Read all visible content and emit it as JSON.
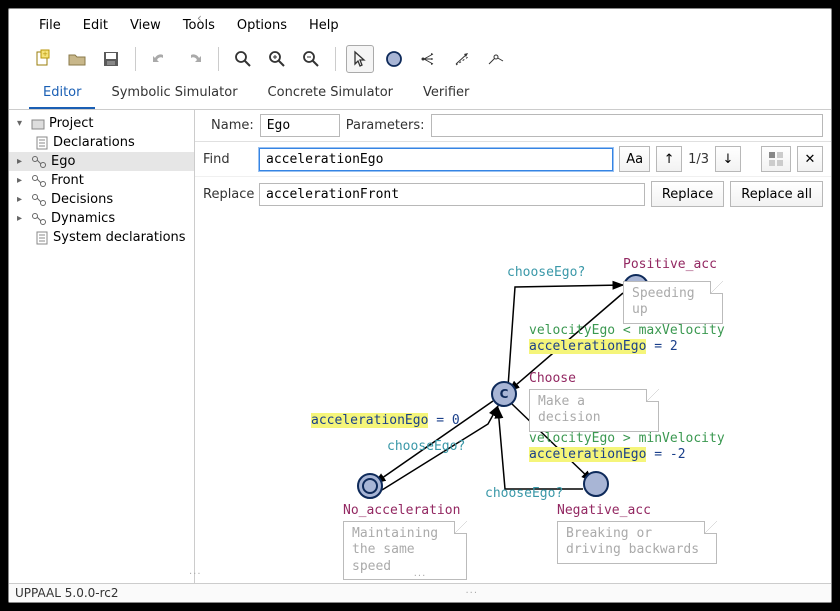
{
  "menubar": [
    "File",
    "Edit",
    "View",
    "Tools",
    "Options",
    "Help"
  ],
  "tabs": [
    "Editor",
    "Symbolic Simulator",
    "Concrete Simulator",
    "Verifier"
  ],
  "active_tab": 0,
  "tree": {
    "root": "Project",
    "children": [
      {
        "label": "Declarations",
        "icon": "text",
        "child": true
      },
      {
        "label": "Ego",
        "icon": "template",
        "expandable": true,
        "selected": true
      },
      {
        "label": "Front",
        "icon": "template",
        "expandable": true
      },
      {
        "label": "Decisions",
        "icon": "template",
        "expandable": true
      },
      {
        "label": "Dynamics",
        "icon": "template",
        "expandable": true
      },
      {
        "label": "System declarations",
        "icon": "text",
        "child": true
      }
    ]
  },
  "header": {
    "name_label": "Name:",
    "name_value": "Ego",
    "param_label": "Parameters:",
    "param_value": ""
  },
  "find": {
    "label": "Find",
    "value": "accelerationEgo",
    "aa": "Aa",
    "count": "1/3"
  },
  "replace": {
    "label": "Replace",
    "value": "accelerationFront",
    "btn_replace": "Replace",
    "btn_all": "Replace all"
  },
  "states": {
    "choose": {
      "label": "Choose",
      "desc": "Make a decision"
    },
    "positive": {
      "label": "Positive_acc",
      "desc": "Speeding up"
    },
    "noaccel": {
      "label": "No_acceleration",
      "desc_l1": "Maintaining",
      "desc_l2": "the same speed"
    },
    "negative": {
      "label": "Negative_acc",
      "desc_l1": "Breaking or",
      "desc_l2": "driving backwards"
    }
  },
  "transitions": {
    "t_pos": {
      "sync": "chooseEgo?",
      "guard": "velocityEgo < maxVelocity",
      "assign_hl": "accelerationEgo",
      "assign_rest": " = 2"
    },
    "t_no": {
      "sync": "chooseEgo?",
      "assign_hl": "accelerationEgo",
      "assign_rest": " = 0"
    },
    "t_neg": {
      "sync": "chooseEgo?",
      "guard": "velocityEgo > minVelocity",
      "assign_hl": "accelerationEgo",
      "assign_rest": " = -2"
    }
  },
  "statusbar": "UPPAAL 5.0.0-rc2"
}
